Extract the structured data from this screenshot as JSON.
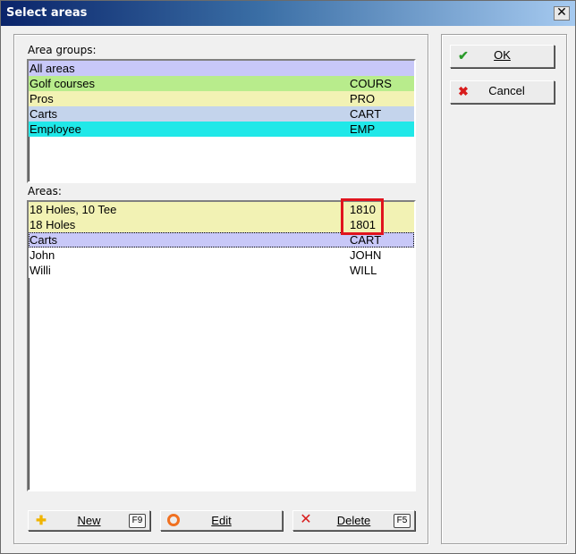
{
  "window": {
    "title": "Select areas",
    "close_glyph": "✕"
  },
  "area_groups": {
    "label": "Area groups:",
    "rows": [
      {
        "name": "All areas",
        "code": "",
        "bg": "#c8c8f8"
      },
      {
        "name": "Golf courses",
        "code": "COURS",
        "bg": "#b8ec8c"
      },
      {
        "name": "Pros",
        "code": "PRO",
        "bg": "#f2f2b4"
      },
      {
        "name": "Carts",
        "code": "CART",
        "bg": "#c4d4ec"
      },
      {
        "name": "Employee",
        "code": "EMP",
        "bg": "#20e8e8"
      }
    ]
  },
  "areas": {
    "label": "Areas:",
    "rows": [
      {
        "name": "18 Holes, 10 Tee",
        "code": "1810",
        "bg": "#f2f2b4"
      },
      {
        "name": "18 Holes",
        "code": "1801",
        "bg": "#f2f2b4"
      },
      {
        "name": "Carts",
        "code": "CART",
        "bg": "#c8c8f8"
      },
      {
        "name": "John",
        "code": "JOHN",
        "bg": "#ffffff"
      },
      {
        "name": "Willi",
        "code": "WILL",
        "bg": "#ffffff"
      }
    ]
  },
  "buttons": {
    "ok": {
      "label": "OK",
      "icon": "check-icon"
    },
    "cancel": {
      "label": "Cancel",
      "icon": "x-icon"
    },
    "new": {
      "label": "New",
      "key": "F9",
      "icon": "plus-icon"
    },
    "edit": {
      "label": "Edit",
      "icon": "circle-icon"
    },
    "delete": {
      "label": "Delete",
      "key": "F5",
      "icon": "x-icon"
    }
  },
  "colors": {
    "accent_green": "#2a9a2a",
    "accent_red": "#d81c1c",
    "plus_yellow": "#f0b400",
    "circle_orange": "#f07020",
    "highlight": "#e0141e"
  }
}
